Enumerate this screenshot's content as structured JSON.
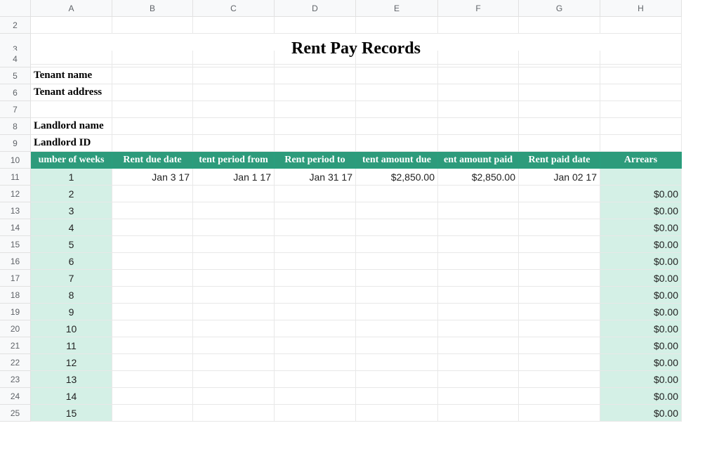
{
  "columns": [
    "A",
    "B",
    "C",
    "D",
    "E",
    "F",
    "G",
    "H"
  ],
  "row_numbers": [
    2,
    3,
    4,
    5,
    6,
    7,
    8,
    9,
    10,
    11,
    12,
    13,
    14,
    15,
    16,
    17,
    18,
    19,
    20,
    21,
    22,
    23,
    24,
    25
  ],
  "title": "Rent Pay Records",
  "labels": {
    "tenant_name": "Tenant name",
    "tenant_address": "Tenant address",
    "landlord_name": "Landlord name",
    "landlord_id": "Landlord ID"
  },
  "headers": {
    "a": "Number of weeks",
    "b": "Rent due date",
    "c": "Rent period from",
    "d": "Rent period to",
    "e": "Rent amount due",
    "f": "Rent amount paid",
    "g": "Rent paid date",
    "h": "Arrears"
  },
  "headers_visible": {
    "a": "umber of weeks",
    "b": "Rent due date",
    "c": "tent period from",
    "d": "Rent period to",
    "e": "tent amount due",
    "f": "ent amount paid",
    "g": "Rent paid date",
    "h": "Arrears"
  },
  "rows": [
    {
      "n": "1",
      "due": "Jan 3 17",
      "from": "Jan 1 17",
      "to": "Jan 31 17",
      "amt_due": "$2,850.00",
      "amt_paid": "$2,850.00",
      "paid_date": "Jan 02 17",
      "arrears": ""
    },
    {
      "n": "2",
      "due": "",
      "from": "",
      "to": "",
      "amt_due": "",
      "amt_paid": "",
      "paid_date": "",
      "arrears": "$0.00"
    },
    {
      "n": "3",
      "due": "",
      "from": "",
      "to": "",
      "amt_due": "",
      "amt_paid": "",
      "paid_date": "",
      "arrears": "$0.00"
    },
    {
      "n": "4",
      "due": "",
      "from": "",
      "to": "",
      "amt_due": "",
      "amt_paid": "",
      "paid_date": "",
      "arrears": "$0.00"
    },
    {
      "n": "5",
      "due": "",
      "from": "",
      "to": "",
      "amt_due": "",
      "amt_paid": "",
      "paid_date": "",
      "arrears": "$0.00"
    },
    {
      "n": "6",
      "due": "",
      "from": "",
      "to": "",
      "amt_due": "",
      "amt_paid": "",
      "paid_date": "",
      "arrears": "$0.00"
    },
    {
      "n": "7",
      "due": "",
      "from": "",
      "to": "",
      "amt_due": "",
      "amt_paid": "",
      "paid_date": "",
      "arrears": "$0.00"
    },
    {
      "n": "8",
      "due": "",
      "from": "",
      "to": "",
      "amt_due": "",
      "amt_paid": "",
      "paid_date": "",
      "arrears": "$0.00"
    },
    {
      "n": "9",
      "due": "",
      "from": "",
      "to": "",
      "amt_due": "",
      "amt_paid": "",
      "paid_date": "",
      "arrears": "$0.00"
    },
    {
      "n": "10",
      "due": "",
      "from": "",
      "to": "",
      "amt_due": "",
      "amt_paid": "",
      "paid_date": "",
      "arrears": "$0.00"
    },
    {
      "n": "11",
      "due": "",
      "from": "",
      "to": "",
      "amt_due": "",
      "amt_paid": "",
      "paid_date": "",
      "arrears": "$0.00"
    },
    {
      "n": "12",
      "due": "",
      "from": "",
      "to": "",
      "amt_due": "",
      "amt_paid": "",
      "paid_date": "",
      "arrears": "$0.00"
    },
    {
      "n": "13",
      "due": "",
      "from": "",
      "to": "",
      "amt_due": "",
      "amt_paid": "",
      "paid_date": "",
      "arrears": "$0.00"
    },
    {
      "n": "14",
      "due": "",
      "from": "",
      "to": "",
      "amt_due": "",
      "amt_paid": "",
      "paid_date": "",
      "arrears": "$0.00"
    },
    {
      "n": "15",
      "due": "",
      "from": "",
      "to": "",
      "amt_due": "",
      "amt_paid": "",
      "paid_date": "",
      "arrears": "$0.00"
    }
  ]
}
